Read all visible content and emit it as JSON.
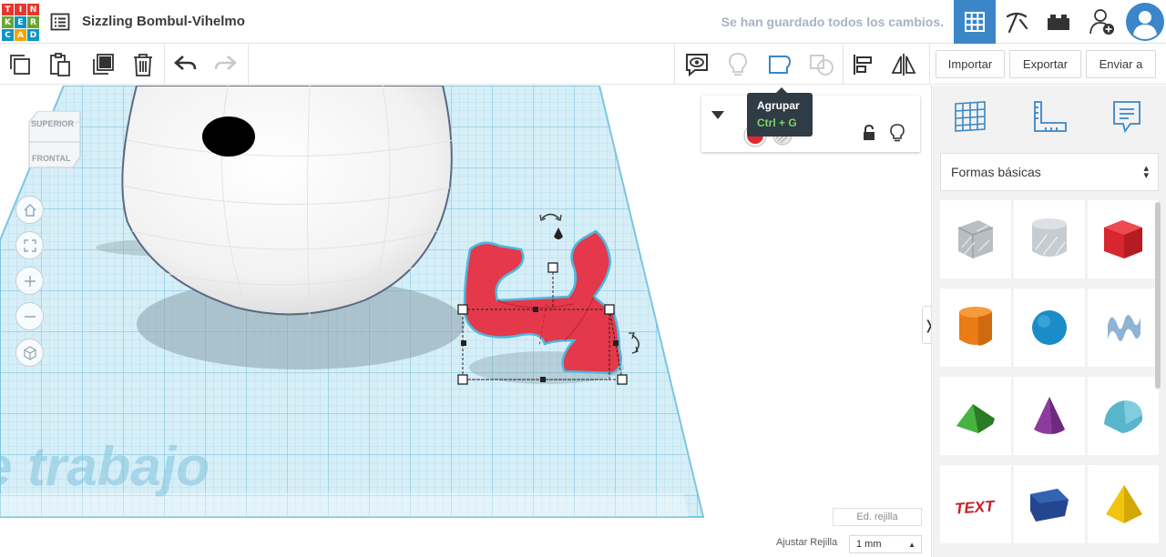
{
  "header": {
    "logo_letters": [
      "T",
      "I",
      "N",
      "K",
      "E",
      "R",
      "C",
      "A",
      "D"
    ],
    "logo_colors": [
      "#e7372c",
      "#e7372c",
      "#e7372c",
      "#6aa534",
      "#0e95c5",
      "#6aa534",
      "#0e95c5",
      "#f5a300",
      "#0e95c5"
    ],
    "design_title": "Sizzling Bombul-Vihelmo",
    "save_status": "Se han guardado todos los cambios.",
    "accent": "#3a86c8"
  },
  "toolbar": {
    "import_label": "Importar",
    "export_label": "Exportar",
    "send_label": "Enviar a"
  },
  "tooltip": {
    "title": "Agrupar",
    "shortcut": "Ctrl + G"
  },
  "workspace": {
    "watermark": "e trabajo",
    "viewcube_top": "SUPERIOR",
    "viewcube_front": "FRONTAL",
    "grid_edit_label": "Ed. rejilla",
    "snap_label": "Ajustar Rejilla",
    "snap_value": "1 mm"
  },
  "inspector": {
    "solid_color": "#e3262f"
  },
  "library": {
    "selected": "Formas básicas",
    "shapes": [
      {
        "name": "box-hole",
        "color": "#b9bec4"
      },
      {
        "name": "cylinder-hole",
        "color": "#c7ccd1"
      },
      {
        "name": "box",
        "color": "#d7262d"
      },
      {
        "name": "cylinder",
        "color": "#ea7b16"
      },
      {
        "name": "sphere",
        "color": "#1a8cc7"
      },
      {
        "name": "scribble",
        "color": "#8fb3d4"
      },
      {
        "name": "roof",
        "color": "#3b9a35"
      },
      {
        "name": "cone",
        "color": "#8c3b9e"
      },
      {
        "name": "round-roof",
        "color": "#59b5c9"
      },
      {
        "name": "text",
        "color": "#c32126"
      },
      {
        "name": "polygon",
        "color": "#23468f"
      },
      {
        "name": "pyramid",
        "color": "#f1c40f"
      }
    ]
  }
}
